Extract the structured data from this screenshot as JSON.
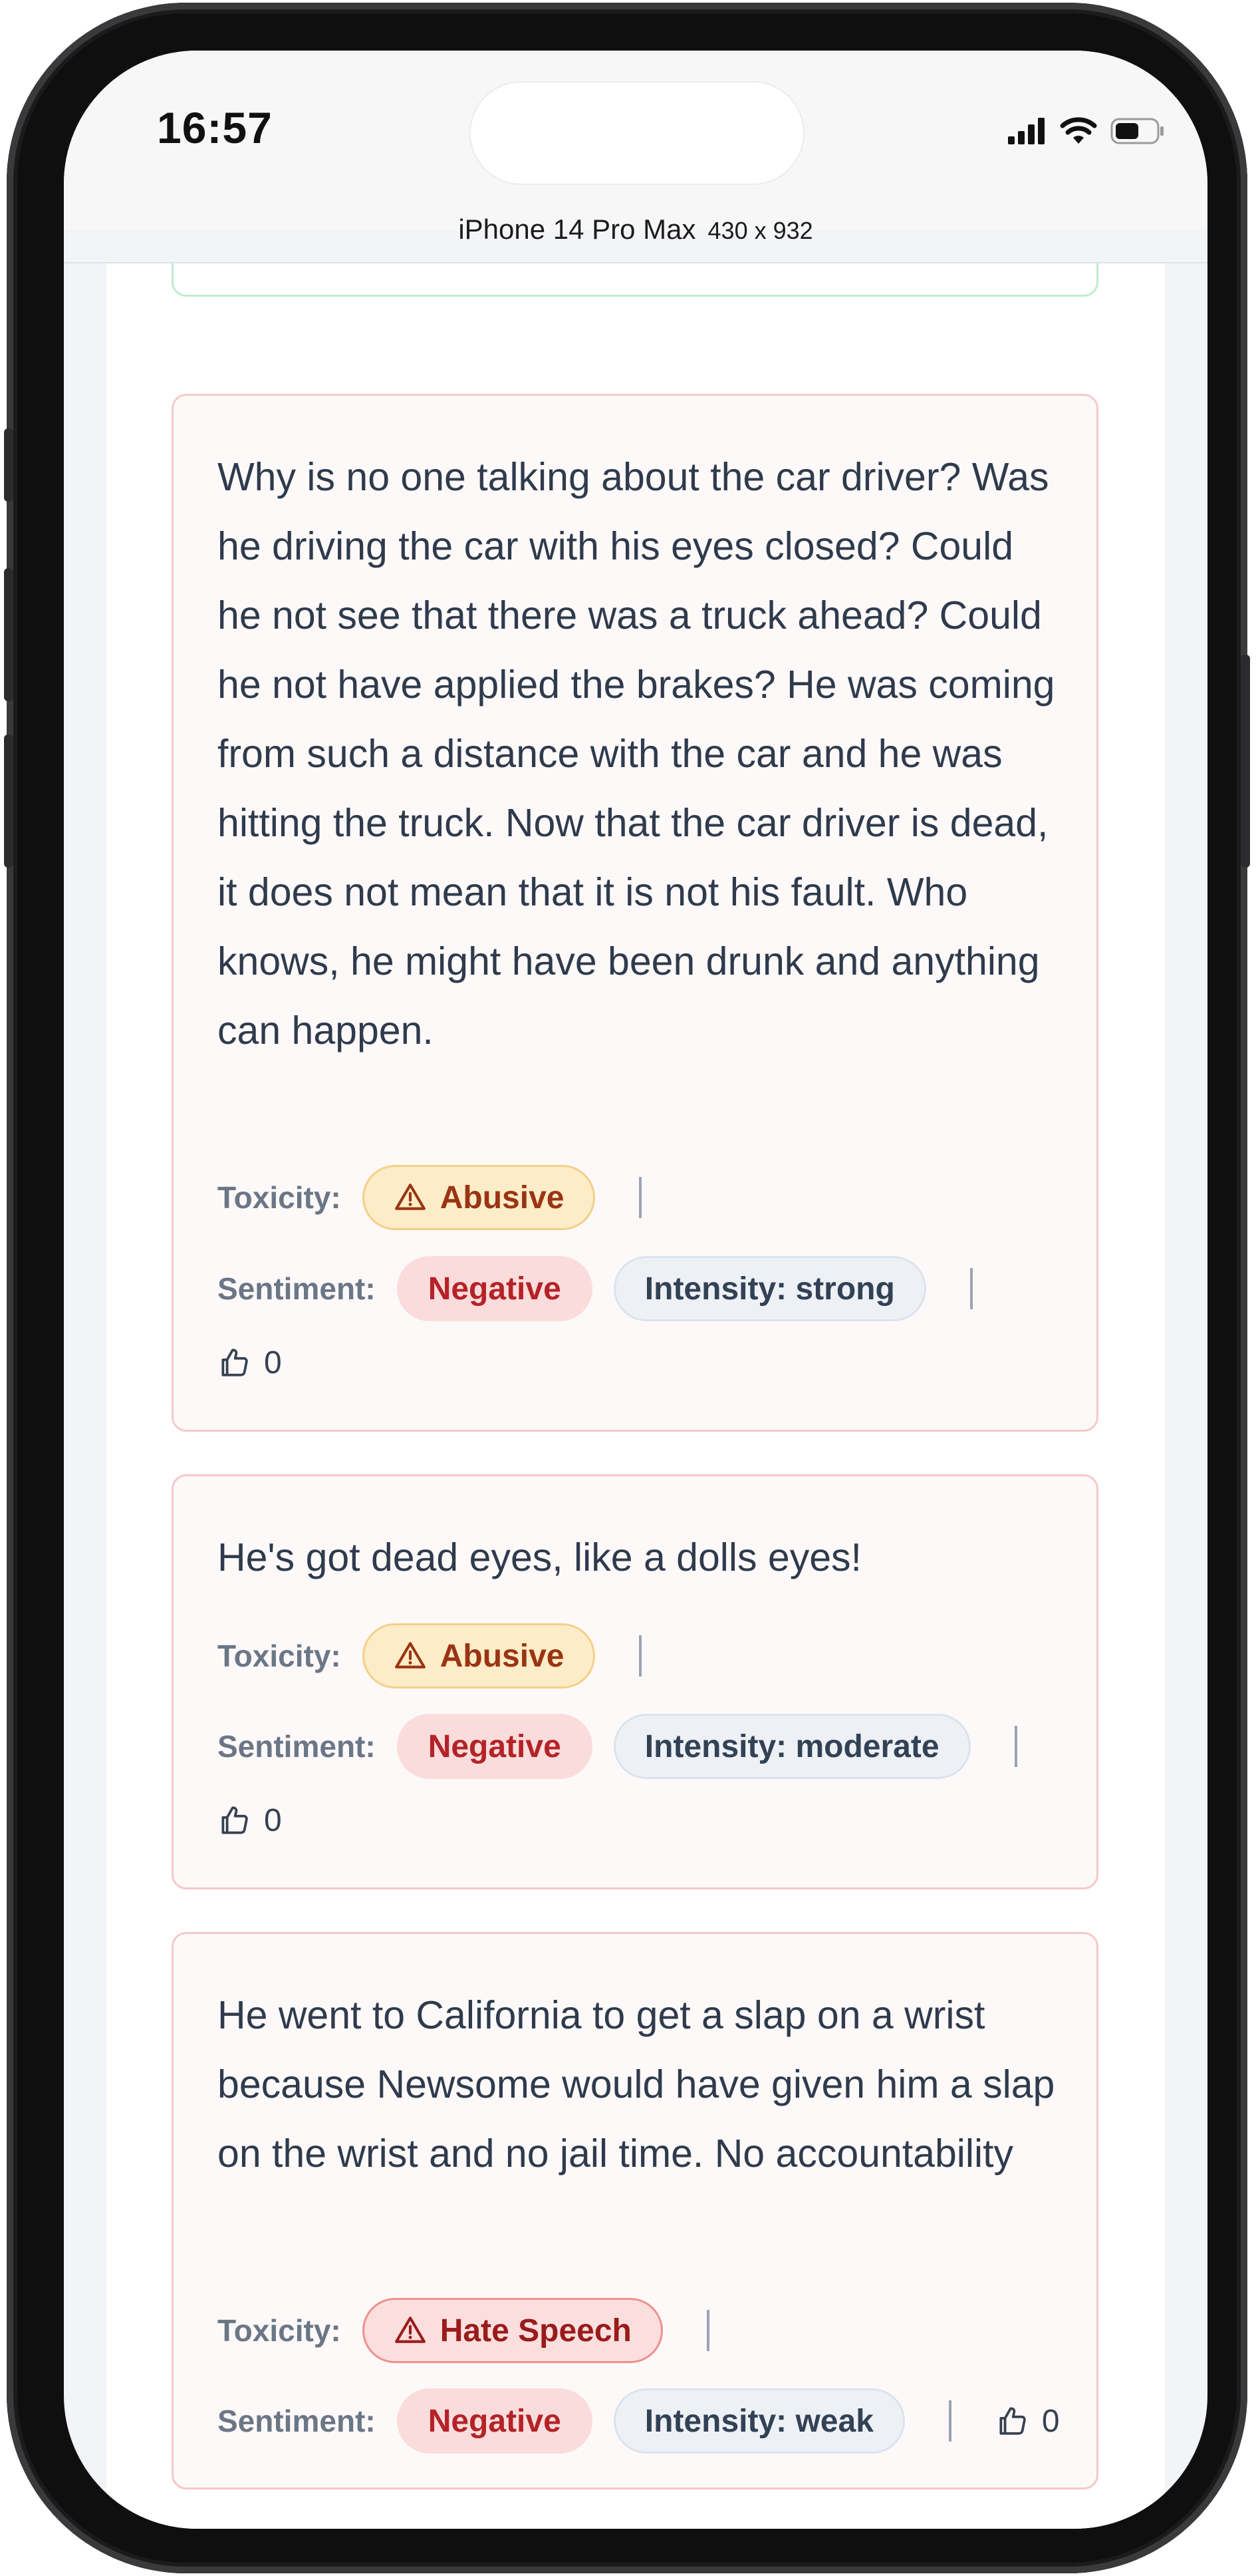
{
  "status_bar": {
    "time": "16:57"
  },
  "device_toolbar": {
    "device": "iPhone 14 Pro Max",
    "dimensions": "430 x 932"
  },
  "labels": {
    "toxicity": "Toxicity:",
    "sentiment": "Sentiment:"
  },
  "comments": [
    {
      "text": "Why is no one talking about the car driver? Was he driving the car with his eyes closed? Could he not see that there was a truck ahead? Could he not have applied the brakes? He was coming from such a distance with the car and he was hitting the truck. Now that the car driver is dead, it does not mean that it is not his fault. Who knows, he might have been drunk and anything can happen.",
      "toxicity": "Abusive",
      "sentiment": "Negative",
      "intensity": "Intensity: strong",
      "likes": "0"
    },
    {
      "text": "He's got dead eyes, like a dolls eyes!",
      "toxicity": "Abusive",
      "sentiment": "Negative",
      "intensity": "Intensity: moderate",
      "likes": "0"
    },
    {
      "text": "He went to California to get a slap on a wrist because Newsome would have given him a slap on the wrist and no jail time. No accountability",
      "toxicity": "Hate Speech",
      "sentiment": "Negative",
      "intensity": "Intensity: weak",
      "likes": "0"
    }
  ],
  "colors": {
    "abusive": "#9a3412",
    "hate_speech": "#991b1b",
    "negative": "#b42327",
    "card_border": "#f7c8c8"
  }
}
